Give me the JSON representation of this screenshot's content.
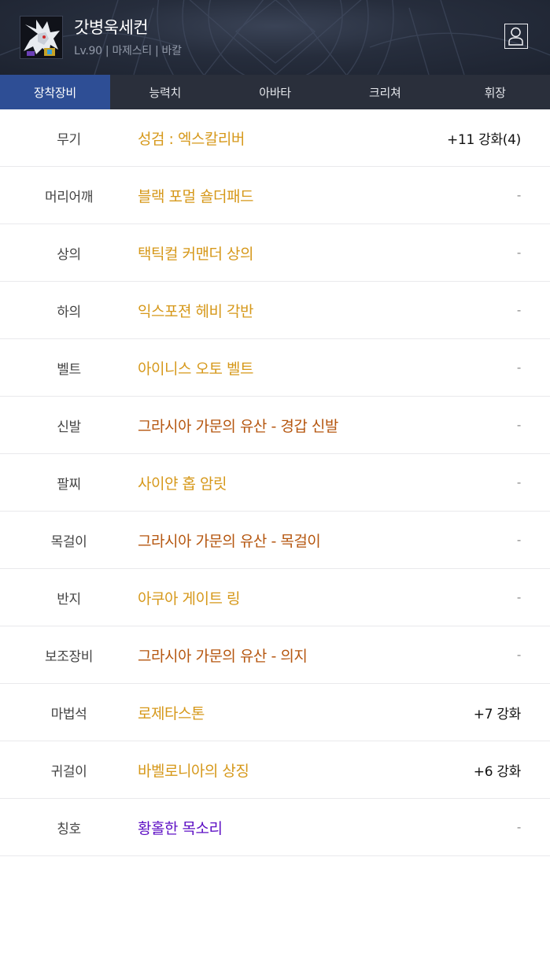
{
  "header": {
    "character_name": "갓병욱세컨",
    "info": "Lv.90 | 마제스티 | 바칼"
  },
  "tabs": [
    {
      "label": "장착장비",
      "active": true
    },
    {
      "label": "능력치",
      "active": false
    },
    {
      "label": "아바타",
      "active": false
    },
    {
      "label": "크리쳐",
      "active": false
    },
    {
      "label": "휘장",
      "active": false
    }
  ],
  "colors": {
    "unique": "#d6981a",
    "legendary": "#b5560f",
    "rare": "#5d0fc4",
    "active_tab": "#2e4e95"
  },
  "equipment": [
    {
      "slot": "무기",
      "item": "성검 : 엑스칼리버",
      "enhance": "+11 강화(4)",
      "color": "#d6981a"
    },
    {
      "slot": "머리어깨",
      "item": "블랙 포멀 숄더패드",
      "enhance": "-",
      "color": "#d6981a"
    },
    {
      "slot": "상의",
      "item": "택틱컬 커맨더 상의",
      "enhance": "-",
      "color": "#d6981a"
    },
    {
      "slot": "하의",
      "item": "익스포젼 헤비 각반",
      "enhance": "-",
      "color": "#d6981a"
    },
    {
      "slot": "벨트",
      "item": "아이니스 오토 벨트",
      "enhance": "-",
      "color": "#d6981a"
    },
    {
      "slot": "신발",
      "item": "그라시아 가문의 유산 - 경갑 신발",
      "enhance": "-",
      "color": "#b5560f"
    },
    {
      "slot": "팔찌",
      "item": "사이얀 홉 암릿",
      "enhance": "-",
      "color": "#d6981a"
    },
    {
      "slot": "목걸이",
      "item": "그라시아 가문의 유산 - 목걸이",
      "enhance": "-",
      "color": "#b5560f"
    },
    {
      "slot": "반지",
      "item": "아쿠아 게이트 링",
      "enhance": "-",
      "color": "#d6981a"
    },
    {
      "slot": "보조장비",
      "item": "그라시아 가문의 유산 - 의지",
      "enhance": "-",
      "color": "#b5560f"
    },
    {
      "slot": "마법석",
      "item": "로제타스톤",
      "enhance": "+7 강화",
      "color": "#d6981a"
    },
    {
      "slot": "귀걸이",
      "item": "바벨로니아의 상징",
      "enhance": "+6 강화",
      "color": "#d6981a"
    },
    {
      "slot": "칭호",
      "item": "황홀한 목소리",
      "enhance": "-",
      "color": "#5d0fc4"
    }
  ]
}
